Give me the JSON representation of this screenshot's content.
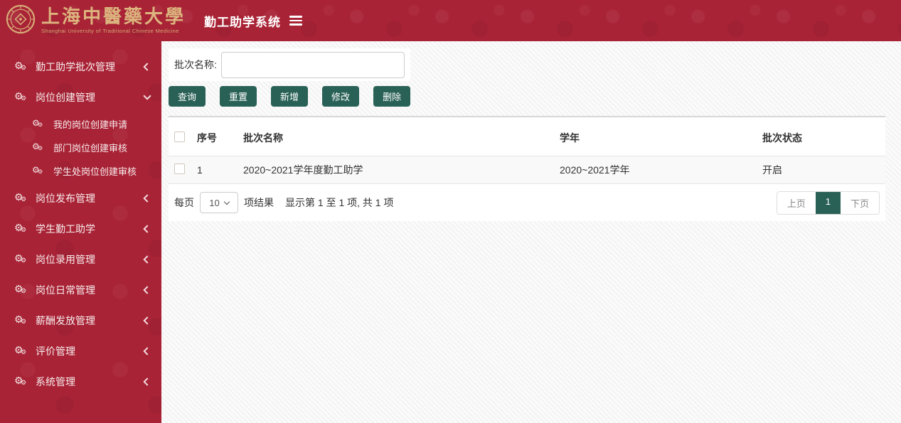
{
  "colors": {
    "brand_red": "#a92336",
    "button_teal": "#2a6157",
    "seal_gold": "#d8b07a"
  },
  "header": {
    "university_cn": "上海中醫藥大學",
    "university_en": "Shanghai University of Traditional Chinese Medicine",
    "system_title": "勤工助学系统"
  },
  "sidebar": {
    "items": [
      {
        "label": "勤工助学批次管理",
        "state": "collapsed"
      },
      {
        "label": "岗位创建管理",
        "state": "expanded",
        "children": [
          "我的岗位创建申请",
          "部门岗位创建审核",
          "学生处岗位创建审核"
        ]
      },
      {
        "label": "岗位发布管理",
        "state": "collapsed"
      },
      {
        "label": "学生勤工助学",
        "state": "collapsed"
      },
      {
        "label": "岗位录用管理",
        "state": "collapsed"
      },
      {
        "label": "岗位日常管理",
        "state": "collapsed"
      },
      {
        "label": "薪酬发放管理",
        "state": "collapsed"
      },
      {
        "label": "评价管理",
        "state": "collapsed"
      },
      {
        "label": "系统管理",
        "state": "collapsed"
      }
    ]
  },
  "main": {
    "search": {
      "label": "批次名称:",
      "value": ""
    },
    "toolbar": {
      "query": "查询",
      "reset": "重置",
      "add": "新增",
      "edit": "修改",
      "delete": "删除"
    },
    "table": {
      "headers": {
        "index": "序号",
        "name": "批次名称",
        "year": "学年",
        "status": "批次状态"
      },
      "rows": [
        {
          "index": "1",
          "name": "2020~2021学年度勤工助学",
          "year": "2020~2021学年",
          "status": "开启"
        }
      ]
    },
    "pagination": {
      "per_page_label": "每页",
      "per_page_value": "10",
      "results_label": "项结果",
      "info": "显示第 1 至 1 项, 共 1 项",
      "prev": "上页",
      "page": "1",
      "next": "下页"
    }
  }
}
